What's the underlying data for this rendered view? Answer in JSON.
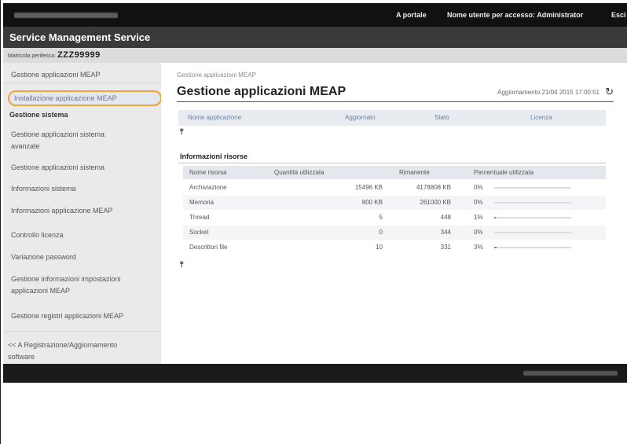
{
  "topbar": {
    "portal_label": "A portale",
    "user_label": "Nome utente per accesso: Administrator",
    "logout_label": "Esci"
  },
  "header": {
    "title": "Service Management Service"
  },
  "serial": {
    "label": "Matricola periferica:",
    "value": "ZZZ99999"
  },
  "sidebar": {
    "top_item": "Gestione applicazioni MEAP",
    "active_item": "Installazione applicazione MEAP",
    "section_title": "Gestione sistema",
    "items": [
      "Gestione applicazioni sistema",
      "avanzate",
      "Gestione applicazioni sistema",
      "Informazioni sistema",
      "Informazioni applicazione MEAP",
      "Controllo licenza",
      "Variazione password",
      "Gestione informazioni impostazioni",
      "applicazioni MEAP",
      "Gestione registri applicazioni MEAP"
    ],
    "bottom_link_1": "<< A Registrazione/Aggiornamento",
    "bottom_link_2": "software"
  },
  "main": {
    "breadcrumb": "Gestione applicazioni MEAP",
    "title": "Gestione applicazioni MEAP",
    "updated_label": "Aggiornamento:21/04 2015 17:00:51",
    "app_table_headers": [
      "Nome applicazione",
      "Aggiornato",
      "Stato",
      "Licenza"
    ],
    "resources_title": "Informazioni risorse",
    "resource_headers": [
      "Nome risorsa",
      "Quantità utilizzata",
      "Rimanente",
      "Percentuale utilizzata"
    ],
    "resources": [
      {
        "name": "Archiviazione",
        "used": "15496 KB",
        "remaining": "4178808 KB",
        "percent": "0%",
        "fill": 0.0
      },
      {
        "name": "Memoria",
        "used": "800 KB",
        "remaining": "261000 KB",
        "percent": "0%",
        "fill": 0.0
      },
      {
        "name": "Thread",
        "used": "5",
        "remaining": "448",
        "percent": "1%",
        "fill": 0.01
      },
      {
        "name": "Socket",
        "used": "0",
        "remaining": "344",
        "percent": "0%",
        "fill": 0.0
      },
      {
        "name": "Descrittori file",
        "used": "10",
        "remaining": "331",
        "percent": "3%",
        "fill": 0.03
      }
    ]
  },
  "colors": {
    "active_outline": "#f0a33a",
    "usage_bar": "#3bb84a"
  }
}
